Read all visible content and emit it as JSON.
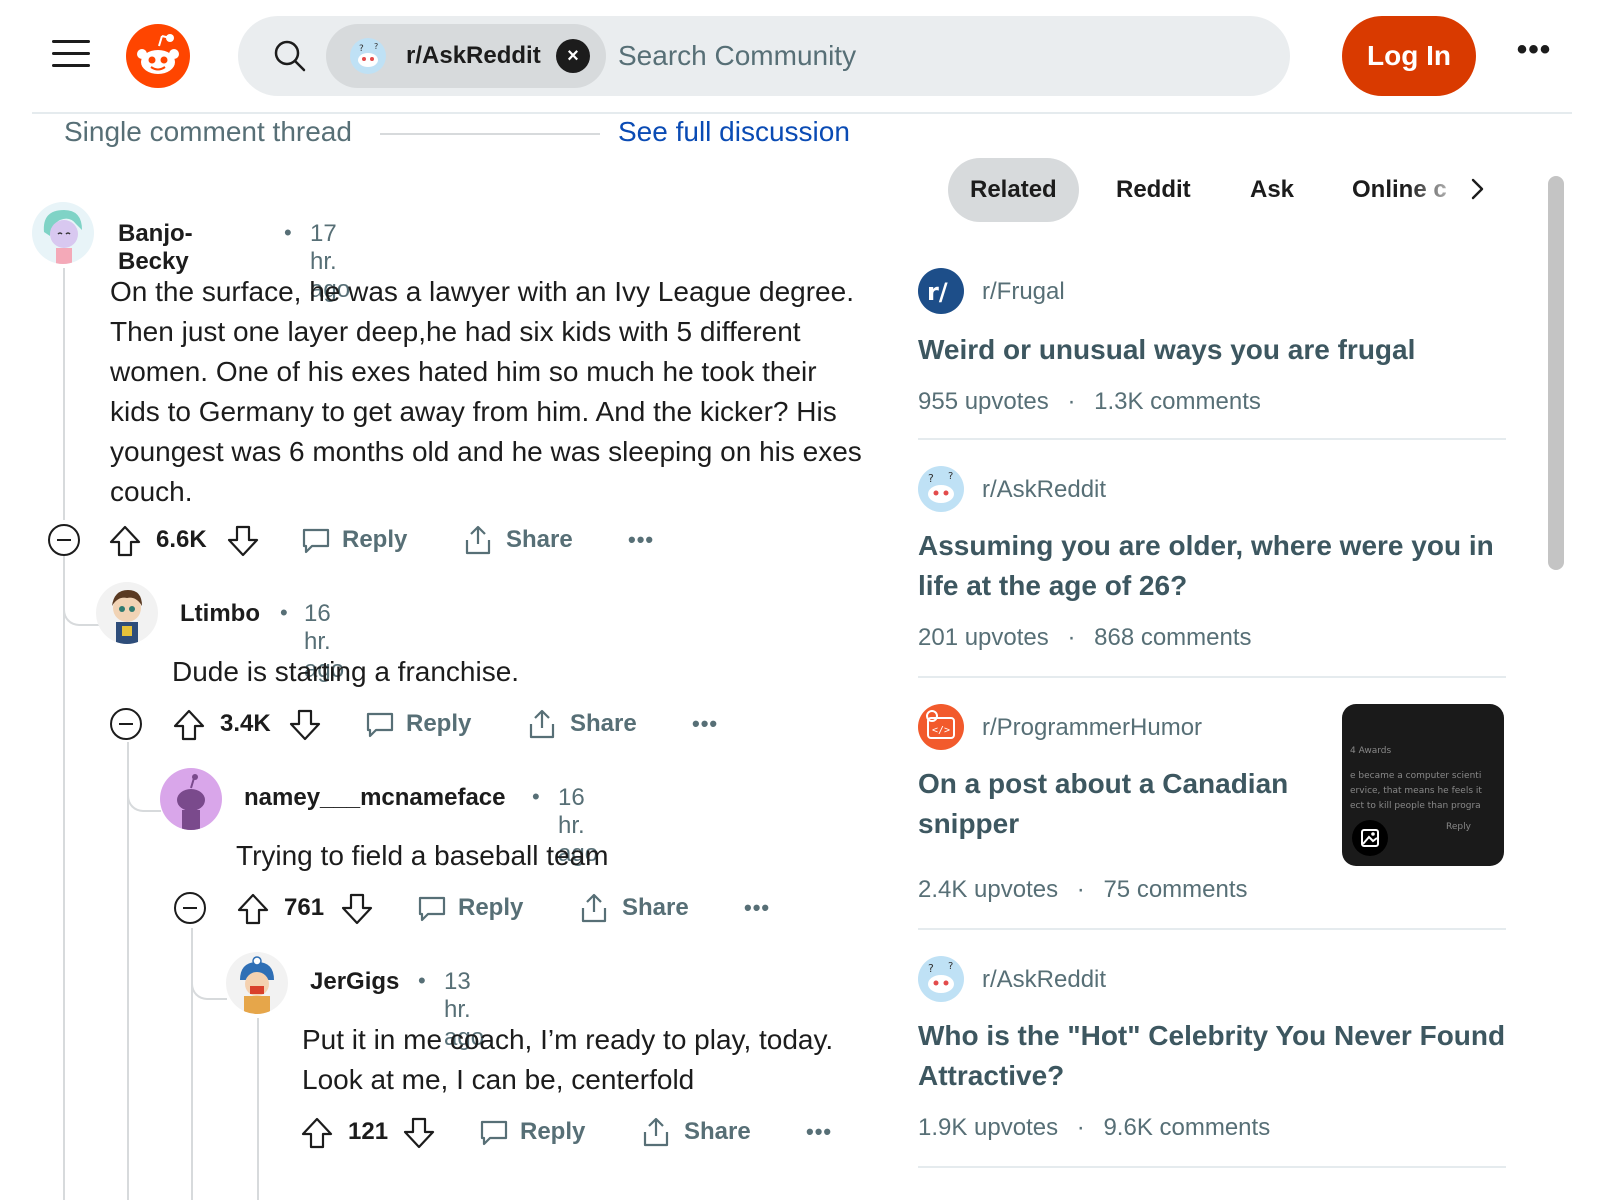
{
  "header": {
    "community_chip": "r/AskReddit",
    "search_placeholder": "Search Community",
    "login_label": "Log In",
    "more_label": "•••"
  },
  "thread": {
    "label": "Single comment thread",
    "full_discussion_link": "See full discussion"
  },
  "comments": [
    {
      "author": "Banjo-Becky",
      "time": "17 hr. ago",
      "body": "On the surface, he was a lawyer with an Ivy League degree. Then just one layer deep,he had six kids with 5 different women. One of his exes hated him so much he took their kids to Germany to get away from him. And the kicker? His youngest was 6 months old and he was sleeping on his exes couch.",
      "score": "6.6K",
      "reply_label": "Reply",
      "share_label": "Share"
    },
    {
      "author": "Ltimbo",
      "time": "16 hr. ago",
      "body": "Dude is starting a franchise.",
      "score": "3.4K",
      "reply_label": "Reply",
      "share_label": "Share"
    },
    {
      "author": "namey___mcnameface",
      "time": "16 hr. ago",
      "body": "Trying to field a baseball team",
      "score": "761",
      "reply_label": "Reply",
      "share_label": "Share"
    },
    {
      "author": "JerGigs",
      "time": "13 hr. ago",
      "body_line1": "Put it in me coach, I’m ready to play, today.",
      "body_line2": "Look at me, I can be, centerfold",
      "score": "121",
      "reply_label": "Reply",
      "share_label": "Share"
    }
  ],
  "sidebar": {
    "tabs": [
      "Related",
      "Reddit",
      "Ask",
      "Online c"
    ],
    "cards": [
      {
        "subreddit": "r/Frugal",
        "title": "Weird or unusual ways you are frugal",
        "upvotes": "955 upvotes",
        "comments": "1.3K comments"
      },
      {
        "subreddit": "r/AskReddit",
        "title": "Assuming you are older, where were you in life at the age of 26?",
        "upvotes": "201 upvotes",
        "comments": "868 comments"
      },
      {
        "subreddit": "r/ProgrammerHumor",
        "title": "On a post about a Canadian snipper",
        "upvotes": "2.4K upvotes",
        "comments": "75 comments",
        "thumb_lines": [
          "4 Awards",
          "e became a computer scienti",
          "ervice, that means he feels it",
          "ect to kill people than progra",
          "Reply"
        ]
      },
      {
        "subreddit": "r/AskReddit",
        "title": "Who is the \"Hot\" Celebrity You Never Found Attractive?",
        "upvotes": "1.9K upvotes",
        "comments": "9.6K comments"
      }
    ],
    "stat_separator": "·"
  },
  "colors": {
    "brand": "#ff4500",
    "login": "#d93a00",
    "link": "#0a4bb4",
    "muted": "#576f76",
    "card_title": "#3d5760"
  },
  "icons": [
    "hamburger-icon",
    "reddit-logo-icon",
    "search-icon",
    "close-icon",
    "upvote-icon",
    "downvote-icon",
    "comment-icon",
    "share-icon",
    "more-icon",
    "collapse-icon",
    "chevron-right-icon",
    "image-icon"
  ]
}
